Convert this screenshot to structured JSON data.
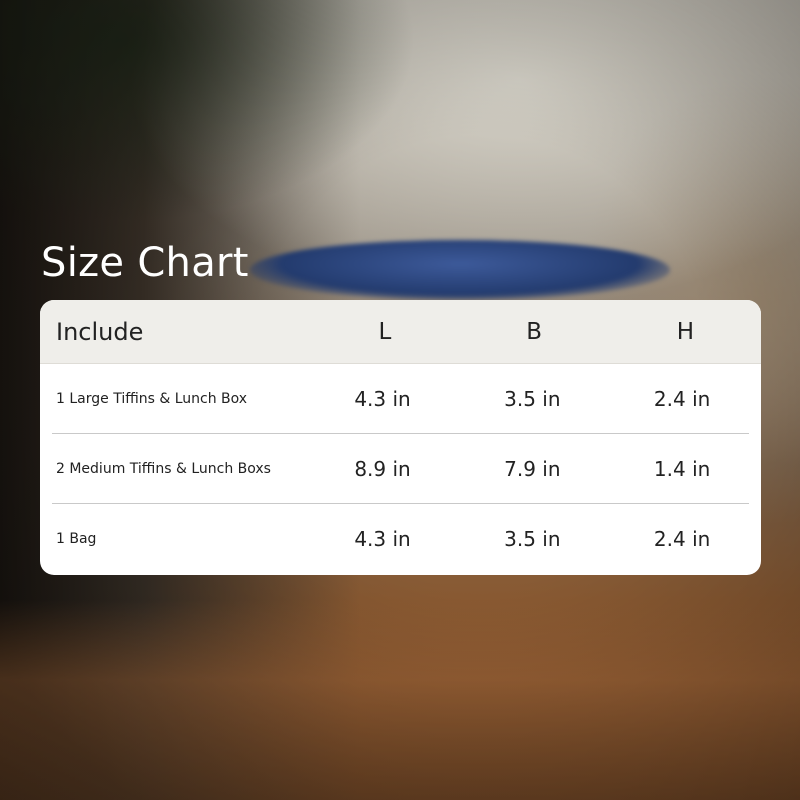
{
  "title": "Size Chart",
  "table": {
    "headers": {
      "include": "Include",
      "l": "L",
      "b": "B",
      "h": "H"
    },
    "rows": [
      {
        "include": "1 Large Tiffins & Lunch Box",
        "l": "4.3 in",
        "b": "3.5 in",
        "h": "2.4 in"
      },
      {
        "include": "2 Medium Tiffins & Lunch Boxs",
        "l": "8.9 in",
        "b": "7.9 in",
        "h": "1.4 in"
      },
      {
        "include": "1 Bag",
        "l": "4.3 in",
        "b": "3.5 in",
        "h": "2.4 in"
      }
    ]
  }
}
